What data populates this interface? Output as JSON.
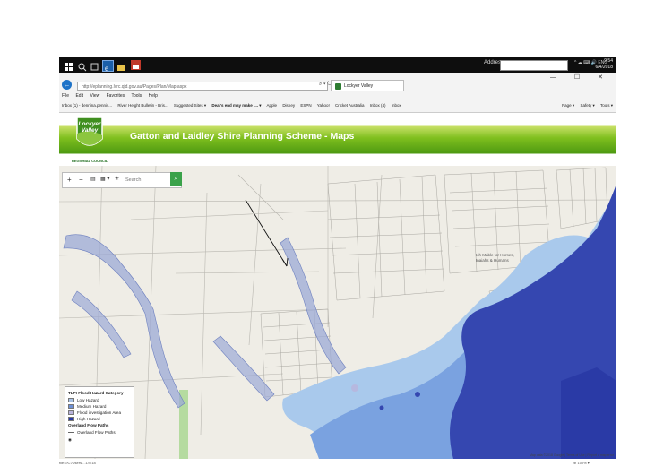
{
  "taskbar": {
    "address_label": "Address",
    "tray_text": "^ ☁ ⌨ 🔊 ENG",
    "time": "9:54",
    "date": "6/4/2018"
  },
  "browser": {
    "url": "http://eplanning.lvrc.qld.gov.au/Pages/Plan/Map.aspx",
    "url_controls": "⌕ ▾ ↻",
    "tab_title": "Lockyer Valley",
    "window_controls": "— ☐ ✕",
    "menu": [
      "File",
      "Edit",
      "View",
      "Favorites",
      "Tools",
      "Help"
    ],
    "favorites": [
      "Inbox (1) - dennina.pennis...",
      "River Height Bulletin - Bris...",
      "Suggested Sites ▾",
      "Deal's end may make i... ▾",
      "Apple",
      "Disney",
      "ESPN",
      "Yahoo!",
      "Cricket Australia",
      "Inbox (4)",
      "Inbox"
    ],
    "commands": [
      "Page ▾",
      "Safety ▾",
      "Tools ▾"
    ]
  },
  "site": {
    "logo_top": "Lockyer",
    "logo_bottom": "Valley",
    "logo_sub": "REGIONAL COUNCIL",
    "title": "Gatton and Laidley Shire Planning Scheme - Maps"
  },
  "map": {
    "toolbar": {
      "zoom_in": "+",
      "zoom_out": "−",
      "layers": "▤",
      "basemap": "▦ ▾",
      "settings": "✳"
    },
    "search_placeholder": "Search",
    "place_label": "Ich Mable for Horses, Inaiahs & Humans",
    "attribution": "Map data ©2018 Google | Terms of Use | Report a map error"
  },
  "legend": {
    "title": "TLPI Flood Hazard Category",
    "items": [
      {
        "label": "Low Hazard",
        "color": "#a9c3e6"
      },
      {
        "label": "Medium Hazard",
        "color": "#6c8fd6"
      },
      {
        "label": "Flood investigation Area",
        "color": "#b9b4dc"
      },
      {
        "label": "High Hazard",
        "color": "#2a3aa6"
      }
    ],
    "overland_title": "Overland Flow Paths",
    "overland_item": "Overland Flow Paths"
  },
  "footer": {
    "left": "file:///C:/Users/...1/4/18",
    "right": "⊕ 100% ▾"
  }
}
